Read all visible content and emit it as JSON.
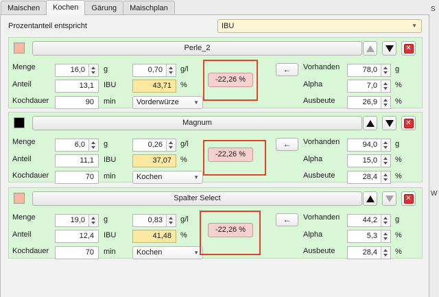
{
  "tabs": [
    {
      "label": "Maischen"
    },
    {
      "label": "Kochen"
    },
    {
      "label": "Gärung"
    },
    {
      "label": "Maischplan"
    }
  ],
  "prozentanteil": {
    "label": "Prozentanteil entspricht",
    "value": "IBU"
  },
  "right_strip": {
    "letter_top": "S",
    "letter_bottom": "W"
  },
  "labels": {
    "menge": "Menge",
    "anteil": "Anteil",
    "kochdauer": "Kochdauer",
    "vorhanden": "Vorhanden",
    "alpha": "Alpha",
    "ausbeute": "Ausbeute",
    "unit_g": "g",
    "unit_ibu": "IBU",
    "unit_min": "min",
    "unit_gl": "g/l",
    "unit_pct": "%",
    "arrow_btn": "←"
  },
  "colors": {
    "card_bg": "#d9f7d7",
    "highlight": "#e0432a",
    "pct_btn_bg": "#f6cfcf",
    "ibu_field_bg": "#fbe9a2"
  },
  "hops": [
    {
      "name": "Perle_2",
      "swatch_color": "#f7b9a1",
      "up_enabled": false,
      "down_enabled": true,
      "menge": "16,0",
      "menge_gl": "0,70",
      "anteil": "13,1",
      "ibu": "43,71",
      "kochdauer": "90",
      "zeitpunkt": "Vorderwürze",
      "prozent": "-22,26 %",
      "vorhanden": "78,0",
      "alpha": "7,0",
      "ausbeute": "26,9"
    },
    {
      "name": "Magnum",
      "swatch_color": "#000000",
      "up_enabled": true,
      "down_enabled": true,
      "menge": "6,0",
      "menge_gl": "0,26",
      "anteil": "11,1",
      "ibu": "37,07",
      "kochdauer": "70",
      "zeitpunkt": "Kochen",
      "prozent": "-22,26 %",
      "vorhanden": "94,0",
      "alpha": "15,0",
      "ausbeute": "28,4"
    },
    {
      "name": "Spalter Select",
      "swatch_color": "#f7b9a1",
      "up_enabled": true,
      "down_enabled": false,
      "menge": "19,0",
      "menge_gl": "0,83",
      "anteil": "12,4",
      "ibu": "41,48",
      "kochdauer": "70",
      "zeitpunkt": "Kochen",
      "prozent": "-22,26 %",
      "vorhanden": "44,2",
      "alpha": "5,3",
      "ausbeute": "28,4"
    }
  ]
}
